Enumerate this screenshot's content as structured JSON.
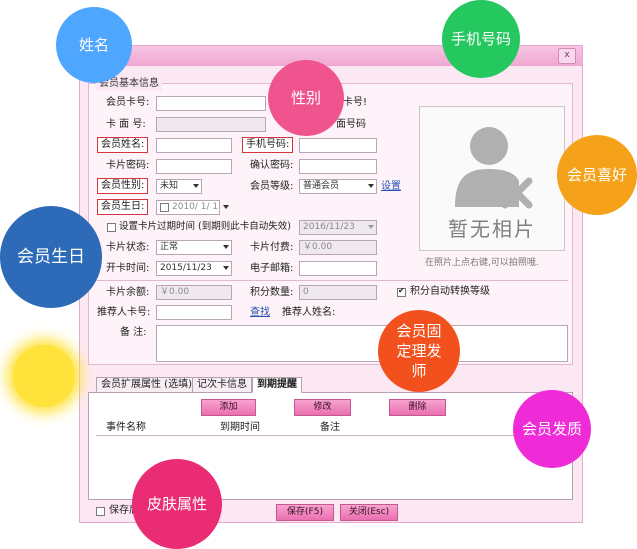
{
  "window": {
    "close_label": "x"
  },
  "basic": {
    "legend": "会员基本信息",
    "card_no_label": "会员卡号:",
    "card_face_label": "卡 面 号:",
    "name_label": "会员姓名:",
    "phone_label": "手机号码:",
    "password_label": "卡片密码:",
    "confirm_label": "确认密码:",
    "gender_label": "会员性别:",
    "gender_value": "未知",
    "level_label": "会员等级:",
    "level_value": "普通会员",
    "level_link": "设置",
    "birthday_label": "会员生日:",
    "birthday_value": "2010/ 1/ 1",
    "partial_card_label": "卡号!",
    "partial_face_label": "面号码",
    "expire_label": "设置卡片过期时间 (到期则此卡自动失效)",
    "expire_value": "2016/11/23",
    "status_label": "卡片状态:",
    "status_value": "正常",
    "fee_label": "卡片付费:",
    "fee_value": "￥0.00",
    "open_label": "开卡时间:",
    "open_value": "2015/11/23",
    "email_label": "电子邮箱:",
    "balance_label": "卡片余额:",
    "balance_value": "￥0.00",
    "points_label": "积分数量:",
    "points_value": "0",
    "auto_convert_label": "积分自动转换等级",
    "referrer_card_label": "推荐人卡号:",
    "lookup_link": "查找",
    "referrer_name_label": "推荐人姓名:",
    "remark_label": "备 注:"
  },
  "photo": {
    "placeholder": "暂无相片",
    "hint": "在照片上点右键,可以拍照哦."
  },
  "tabs": [
    "会员扩展属性 (选填)",
    "记次卡信息",
    "到期提醒"
  ],
  "reminder": {
    "add": "添加",
    "edit": "修改",
    "delete": "删除",
    "columns": [
      "事件名称",
      "到期时间",
      "备注"
    ]
  },
  "footer": {
    "save_check_label": "保存后",
    "save": "保存(F5)",
    "close": "关闭(Esc)"
  },
  "callouts": {
    "name": "姓名",
    "phone": "手机号码",
    "gender": "性别",
    "hobby": "会员喜好",
    "birthday": "会员生日",
    "stylist": "会员固定理发师",
    "hair": "会员发质",
    "skin": "皮肤属性"
  },
  "colors": {
    "name": "#4ea6ff",
    "phone": "#25c75f",
    "gender": "#f0548f",
    "hobby": "#f5a11a",
    "birthday": "#2d6ab8",
    "stylist": "#f2501d",
    "hair": "#ef2bd8",
    "skin": "#e92c74",
    "yellow_dot": "#ffe23a"
  }
}
